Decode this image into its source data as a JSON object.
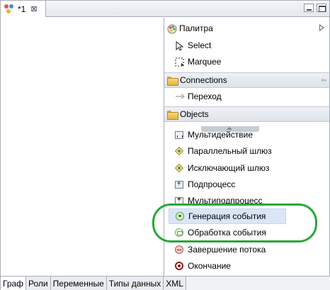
{
  "editor": {
    "tab_title": "*1",
    "tab_close": "⊠"
  },
  "palette": {
    "title": "Палитра",
    "tools": [
      {
        "label": "Select",
        "icon": "arrow-cursor-icon"
      },
      {
        "label": "Marquee",
        "icon": "marquee-icon"
      }
    ],
    "drawers": {
      "connections": {
        "label": "Connections",
        "items": [
          {
            "label": "Переход",
            "icon": "transition-arrow-icon"
          }
        ]
      },
      "objects": {
        "label": "Objects",
        "items": [
          {
            "label": "Мультидействие",
            "icon": "multi-action-icon"
          },
          {
            "label": "Параллельный шлюз",
            "icon": "parallel-gateway-icon"
          },
          {
            "label": "Исключающий шлюз",
            "icon": "exclusive-gateway-icon"
          },
          {
            "label": "Подпроцесс",
            "icon": "subprocess-icon"
          },
          {
            "label": "Мультиподпроцесс",
            "icon": "multi-subprocess-icon"
          },
          {
            "label": "Генерация события",
            "icon": "event-generation-icon",
            "selected": true
          },
          {
            "label": "Обработка события",
            "icon": "event-handling-icon"
          },
          {
            "label": "Завершение потока",
            "icon": "end-flow-icon"
          },
          {
            "label": "Окончание",
            "icon": "end-icon"
          }
        ]
      }
    },
    "pin_glyph": "⇦"
  },
  "bottom_tabs": [
    {
      "label": "Граф",
      "active": true
    },
    {
      "label": "Роли"
    },
    {
      "label": "Переменные"
    },
    {
      "label": "Типы данных"
    },
    {
      "label": "XML"
    }
  ],
  "colors": {
    "highlight": "#27a83a",
    "selection": "#dae6f6"
  }
}
